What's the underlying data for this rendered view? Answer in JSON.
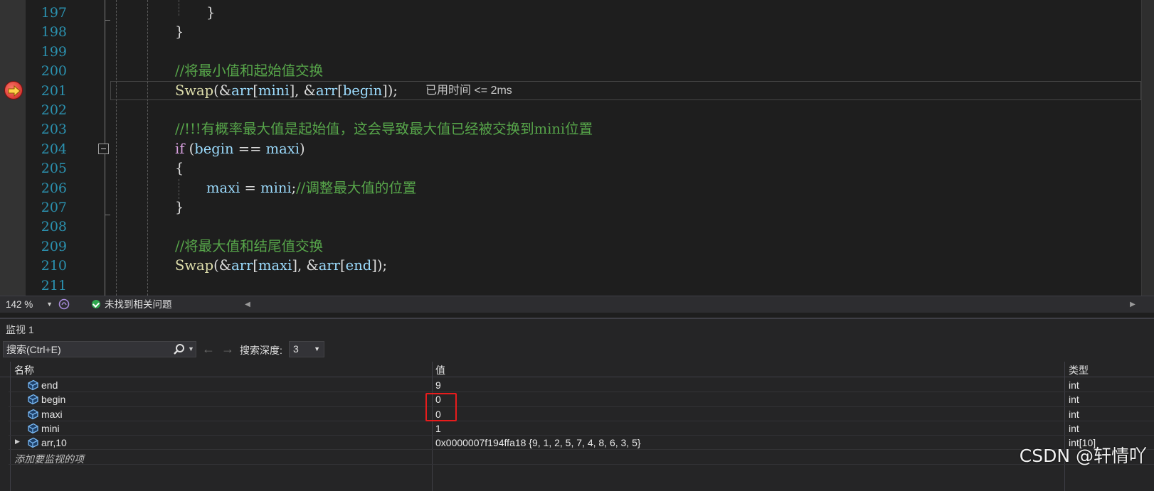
{
  "editor": {
    "lines": [
      {
        "num": "197",
        "code": "}"
      },
      {
        "num": "198",
        "code": "}"
      },
      {
        "num": "199",
        "code": ""
      },
      {
        "num": "200",
        "comment": "//将最小值和起始值交换"
      },
      {
        "num": "201",
        "fn": "Swap",
        "p1": "(&",
        "v1": "arr",
        "p2": "[",
        "v2": "mini",
        "p3": "], &",
        "v3": "arr",
        "p4": "[",
        "v4": "begin",
        "p5": "]);"
      },
      {
        "num": "202",
        "code": ""
      },
      {
        "num": "203",
        "comment": "//!!!有概率最大值是起始值，这会导致最大值已经被交换到mini位置"
      },
      {
        "num": "204",
        "kw": "if",
        "p1": " (",
        "v1": "begin",
        "p2": " == ",
        "v2": "maxi",
        "p3": ")"
      },
      {
        "num": "205",
        "code": "{"
      },
      {
        "num": "206",
        "v1": "maxi",
        "p1": " = ",
        "v2": "mini",
        "p2": ";",
        "comment": "//调整最大值的位置"
      },
      {
        "num": "207",
        "code": "}"
      },
      {
        "num": "208",
        "code": ""
      },
      {
        "num": "209",
        "comment": "//将最大值和结尾值交换"
      },
      {
        "num": "210",
        "fn": "Swap",
        "p1": "(&",
        "v1": "arr",
        "p2": "[",
        "v2": "maxi",
        "p3": "], &",
        "v3": "arr",
        "p4": "[",
        "v4": "end",
        "p5": "]);"
      },
      {
        "num": "211",
        "code": ""
      }
    ],
    "elapsed_hint": "已用时间 <= 2ms"
  },
  "status_bar": {
    "zoom": "142 %",
    "issues": "未找到相关问题"
  },
  "watch": {
    "title": "监视 1",
    "search_placeholder": "搜索(Ctrl+E)",
    "depth_label": "搜索深度:",
    "depth_value": "3",
    "columns": {
      "name": "名称",
      "value": "值",
      "type": "类型"
    },
    "rows": [
      {
        "name": "end",
        "value": "9",
        "type": "int"
      },
      {
        "name": "begin",
        "value": "0",
        "type": "int"
      },
      {
        "name": "maxi",
        "value": "0",
        "type": "int"
      },
      {
        "name": "mini",
        "value": "1",
        "type": "int"
      },
      {
        "name": "arr,10",
        "value": "0x0000007f194ffa18 {9, 1, 2, 5, 7, 4, 8, 6, 3, 5}",
        "type": "int[10]"
      }
    ],
    "add_item": "添加要监视的项"
  },
  "watermark": "CSDN @轩情吖",
  "colors": {
    "line_number": "#2b91af",
    "comment": "#57a64a",
    "function": "#dcdcaa",
    "variable": "#9cdcfe",
    "keyword": "#d8a0df",
    "highlight": "#e81c1c"
  }
}
